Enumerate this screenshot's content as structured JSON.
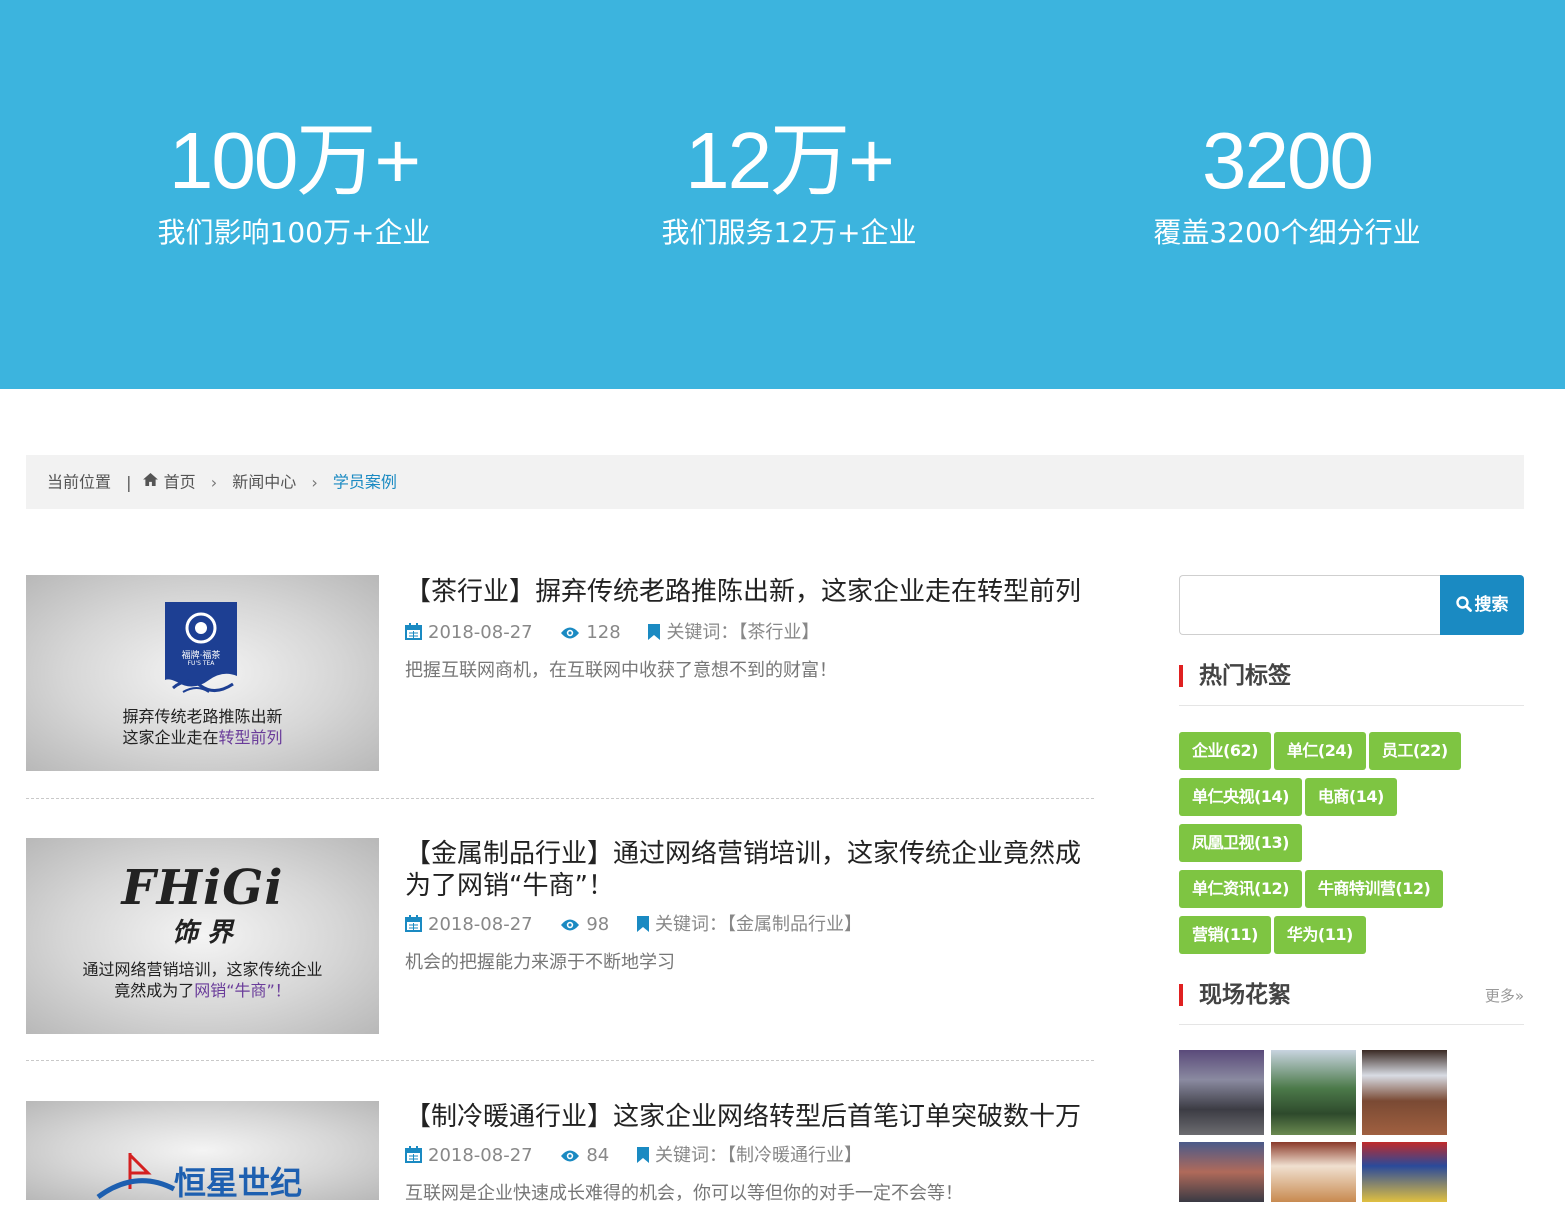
{
  "stats": [
    {
      "number": "100万+",
      "desc": "我们影响100万+企业"
    },
    {
      "number": "12万+",
      "desc": "我们服务12万+企业"
    },
    {
      "number": "3200",
      "desc": "覆盖3200个细分行业"
    }
  ],
  "breadcrumb": {
    "label": "当前位置",
    "separator": "|",
    "items": [
      "首页",
      "新闻中心",
      "学员案例"
    ]
  },
  "articles": [
    {
      "title": "【茶行业】摒弃传统老路推陈出新，这家企业走在转型前列",
      "date": "2018-08-27",
      "views": "128",
      "keywords": "关键词：【茶行业】",
      "summary": "把握互联网商机，在互联网中收获了意想不到的财富！",
      "thumb": {
        "logo_text": "福牌·福茶",
        "logo_sub": "FU'S TEA",
        "caption_line1": "摒弃传统老路推陈出新",
        "caption_line2_plain": "这家企业走在",
        "caption_line2_hl": "转型前列"
      }
    },
    {
      "title": "【金属制品行业】通过网络营销培训，这家传统企业竟然成为了网销“牛商”！",
      "date": "2018-08-27",
      "views": "98",
      "keywords": "关键词：【金属制品行业】",
      "summary": "机会的把握能力来源于不断地学习",
      "thumb": {
        "logo_text": "FHiGi",
        "logo_sub": "饰 界",
        "caption_line1": "通过网络营销培训，这家传统企业",
        "caption_line2_plain": "竟然成为了",
        "caption_line2_hl": "网销“牛商”！"
      }
    },
    {
      "title": "【制冷暖通行业】这家企业网络转型后首笔订单突破数十万",
      "date": "2018-08-27",
      "views": "84",
      "keywords": "关键词：【制冷暖通行业】",
      "summary": "互联网是企业快速成长难得的机会，你可以等但你的对手一定不会等！",
      "thumb": {
        "logo_text": "恒星世纪"
      }
    }
  ],
  "search": {
    "placeholder": "",
    "button_label": "搜索"
  },
  "sidebar": {
    "hot_tags_title": "热门标签",
    "tags": [
      "企业(62)",
      "单仁(24)",
      "员工(22)",
      "单仁央视(14)",
      "电商(14)",
      "凤凰卫视(13)",
      "单仁资讯(12)",
      "牛商特训营(12)",
      "营销(11)",
      "华为(11)"
    ],
    "photos_title": "现场花絮",
    "more_label": "更多»"
  },
  "colors": {
    "hero": "#3cb4de",
    "accent": "#1a8ac2",
    "tag": "#7ec542",
    "marker": "#e02020"
  }
}
